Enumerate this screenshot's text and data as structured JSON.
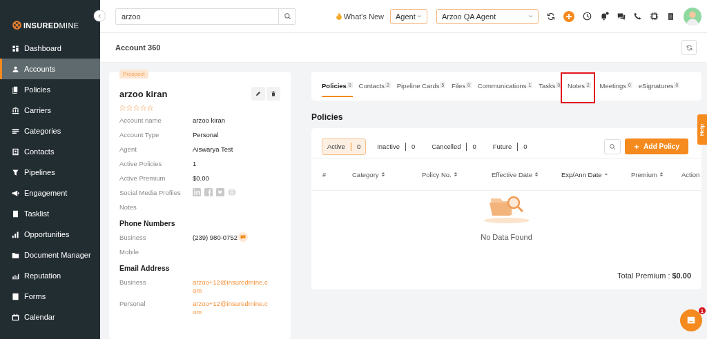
{
  "sidebar": {
    "logo": {
      "bold": "INSURED",
      "light": "MINE"
    },
    "items": [
      {
        "label": "Dashboard",
        "selected": false
      },
      {
        "label": "Accounts",
        "selected": true
      },
      {
        "label": "Policies",
        "selected": false
      },
      {
        "label": "Carriers",
        "selected": false
      },
      {
        "label": "Categories",
        "selected": false
      },
      {
        "label": "Contacts",
        "selected": false
      },
      {
        "label": "Pipelines",
        "selected": false
      },
      {
        "label": "Engagement",
        "selected": false
      },
      {
        "label": "Tasklist",
        "selected": false
      },
      {
        "label": "Opportunities",
        "selected": false
      },
      {
        "label": "Document Manager",
        "selected": false
      },
      {
        "label": "Reputation",
        "selected": false
      },
      {
        "label": "Forms",
        "selected": false
      },
      {
        "label": "Calendar",
        "selected": false
      }
    ]
  },
  "topbar": {
    "search": {
      "value": "arzoo"
    },
    "whats_new": "What's New",
    "role": {
      "value": "Agent"
    },
    "agent": {
      "value": "Arzoo QA Agent"
    },
    "notification_dot": true
  },
  "page_title": "Account 360",
  "account": {
    "badge": "Prospect",
    "name": "arzoo kiran",
    "stars": 0,
    "rows": [
      {
        "kind": "field",
        "label": "Account name",
        "value": "arzoo kiran"
      },
      {
        "kind": "field",
        "label": "Account Type",
        "value": "Personal"
      },
      {
        "kind": "field",
        "label": "Agent",
        "value": "Aiswarya Test"
      },
      {
        "kind": "field",
        "label": "Active Policies",
        "value": "1"
      },
      {
        "kind": "field",
        "label": "Active Premium",
        "value": "$0.00"
      },
      {
        "kind": "social",
        "label": "Social Media Profiles"
      },
      {
        "kind": "field",
        "label": "Notes"
      },
      {
        "kind": "heading",
        "label": "Phone Numbers"
      },
      {
        "kind": "phone",
        "label": "Business",
        "value": "(239) 980-0752"
      },
      {
        "kind": "field",
        "label": "Mobile"
      },
      {
        "kind": "heading",
        "label": "Email Address"
      },
      {
        "kind": "email",
        "label": "Business",
        "value": "arzoo+12@insuredmine.com"
      },
      {
        "kind": "email",
        "label": "Personal",
        "value": "arzoo+12@insuredmine.com"
      }
    ]
  },
  "tabs": [
    {
      "label": "Policies",
      "count": "0",
      "selected": true,
      "highlighted": false
    },
    {
      "label": "Contacts",
      "count": "2",
      "selected": false,
      "highlighted": false
    },
    {
      "label": "Pipeline Cards",
      "count": "5",
      "selected": false,
      "highlighted": false
    },
    {
      "label": "Files",
      "count": "0",
      "selected": false,
      "highlighted": false
    },
    {
      "label": "Communications",
      "count": "1",
      "selected": false,
      "highlighted": false
    },
    {
      "label": "Tasks",
      "count": "0",
      "selected": false,
      "highlighted": false
    },
    {
      "label": "Notes",
      "count": "2",
      "selected": false,
      "highlighted": true
    },
    {
      "label": "Meetings",
      "count": "0",
      "selected": false,
      "highlighted": false
    },
    {
      "label": "eSignatures",
      "count": "0",
      "selected": false,
      "highlighted": false
    }
  ],
  "section_title": "Policies",
  "filters": [
    {
      "label": "Active",
      "count": "0",
      "selected": true
    },
    {
      "label": "Inactive",
      "count": "0",
      "selected": false
    },
    {
      "label": "Cancelled",
      "count": "0",
      "selected": false
    },
    {
      "label": "Future",
      "count": "0",
      "selected": false
    }
  ],
  "add_button": "Add Policy",
  "table": {
    "columns": [
      {
        "label": "#",
        "sortable": false,
        "sorted": false
      },
      {
        "label": "Category",
        "sortable": true,
        "sorted": false
      },
      {
        "label": "Policy No.",
        "sortable": true,
        "sorted": false
      },
      {
        "label": "Effective Date",
        "sortable": true,
        "sorted": false
      },
      {
        "label": "Exp/Ann Date",
        "sortable": true,
        "sorted": true
      },
      {
        "label": "Premium",
        "sortable": true,
        "sorted": false
      },
      {
        "label": "Action",
        "sortable": false,
        "sorted": false
      }
    ],
    "empty_text": "No Data Found"
  },
  "total": {
    "label": "Total Premium :",
    "value": "$0.00"
  },
  "help": "Help",
  "chat_badge": "1"
}
